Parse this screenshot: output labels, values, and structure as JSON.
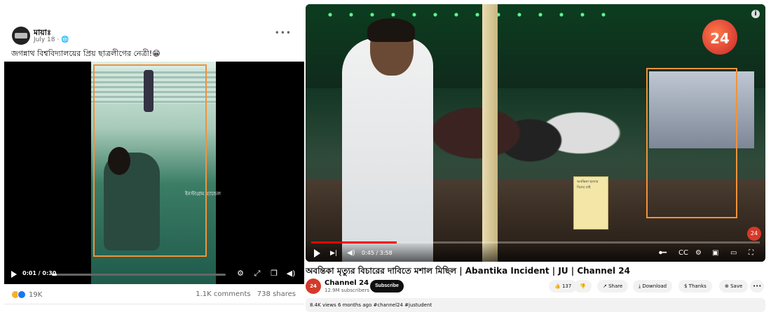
{
  "facebook": {
    "author": "মায়াঃ",
    "date": "July 18 · 🌐",
    "more_label": "•••",
    "caption": "জগন্নাথ বিশ্ববিদ্যালয়ের প্রিয় ছাত্রলীগের নেত্রী!😁",
    "video_overlay_text": "ইনস্টাগ্রাম হ্যান্ডেল",
    "video": {
      "time": "0:01 / 0:30",
      "progress": 0.03
    },
    "controls": {
      "settings_icon": "gear-icon",
      "fullscreen_icon": "expand-icon",
      "pip_icon": "pip-icon",
      "volume_icon": "volume-icon"
    },
    "reactions_count": "19K",
    "comments": "1.1K comments",
    "shares": "738 shares"
  },
  "youtube": {
    "title": "অবন্তিকা মৃত্যুর বিচারের দাবিতে মশাল মিছিল | Abantika Incident | JU | Channel 24",
    "channel_logo_text": "24",
    "channel_avatar_text": "24",
    "channel_name": "Channel 24 ✔",
    "subscribers": "12.9M subscribers",
    "subscribe_label": "Subscribe",
    "likes": "👍 137",
    "dislike": "👎",
    "share_label": "↗ Share",
    "download_label": "⤓ Download",
    "thanks_label": "$ Thanks",
    "save_label": "⊕ Save",
    "more_label": "•••",
    "player": {
      "time": "0:45 / 3:58",
      "progress": 0.19
    },
    "description": "8.4K views  6 months ago  #channel24 #justudent",
    "sign_text": "অবন্তিকা হত্যার বিচার চাই"
  }
}
